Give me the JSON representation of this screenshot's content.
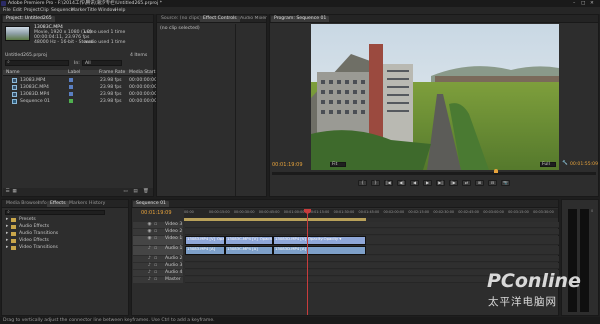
{
  "titlebar": {
    "title": "Adobe Premiere Pro - F:\\2014工作\\腾讯\\潮汐专栏\\Untitled265.prproj *"
  },
  "menu": [
    "File",
    "Edit",
    "Project",
    "Clip",
    "Sequence",
    "Marker",
    "Title",
    "Window",
    "Help"
  ],
  "project": {
    "tabs": [
      "Project: Untitled265"
    ],
    "preview": {
      "name": "13083C.MP4",
      "type": "Movie, 1920 x 1080 (1.0)",
      "duration": "00:00:04:11, 23.976 fps",
      "audio": "48000 Hz - 16-bit - Stereo",
      "usage": "video used 1 time",
      "usage2": "audio used 1 time"
    },
    "count": "4 Items",
    "location": "Untitled265.prproj",
    "in_label": "In:",
    "in_value": "All",
    "search_placeholder": "",
    "columns": [
      "Name",
      "Label",
      "Frame Rate",
      "Media Start"
    ],
    "items": [
      {
        "name": "13083.MP4",
        "label_color": "#5a7fc2",
        "rate": "23.98 fps",
        "start": "00:00:00:00"
      },
      {
        "name": "13083C.MP4",
        "label_color": "#5a7fc2",
        "rate": "23.98 fps",
        "start": "00:00:00:00"
      },
      {
        "name": "13083D.MP4",
        "label_color": "#5a7fc2",
        "rate": "23.98 fps",
        "start": "00:00:00:00"
      },
      {
        "name": "Sequence 01",
        "label_color": "#4fb04f",
        "rate": "23.98 fps",
        "start": "00:00:00:00"
      }
    ]
  },
  "source": {
    "tabs": [
      "Source: (no clips)",
      "Effect Controls",
      "Audio Mixer: Seq"
    ],
    "empty": "(no clip selected)"
  },
  "program": {
    "tab": "Program: Sequence 01",
    "timecode": "00:01:19:09",
    "fit": "Fit",
    "quality": "Full",
    "duration": "00:01:55:09",
    "playhead_fraction": 0.69,
    "controls": [
      "{",
      "}",
      "|◀",
      "◀|",
      "◀",
      "▶",
      "▶|",
      "|▶",
      "⇄",
      "⊞",
      "⊟",
      "📷"
    ]
  },
  "media_browser": {
    "tabs": [
      "Media Browser",
      "Info",
      "Effects",
      "Markers",
      "History"
    ],
    "search_placeholder": "",
    "items": [
      "Presets",
      "Audio Effects",
      "Audio Transitions",
      "Video Effects",
      "Video Transitions"
    ]
  },
  "timeline": {
    "tab": "Sequence 01",
    "timecode": "00:01:19:09",
    "ruler": [
      "00:00",
      "00:00:15:00",
      "00:00:30:00",
      "00:00:45:00",
      "00:01:00:00",
      "00:01:15:00",
      "00:01:30:00",
      "00:01:45:00",
      "00:02:00:00",
      "00:02:15:00",
      "00:02:30:00",
      "00:02:45:00",
      "00:03:00:00",
      "00:03:15:00",
      "00:03:30:00"
    ],
    "tracks": [
      {
        "name": "Video 3",
        "type": "video"
      },
      {
        "name": "Video 2",
        "type": "video"
      },
      {
        "name": "Video 1",
        "type": "video-main"
      },
      {
        "name": "Audio 1",
        "type": "audio-main"
      },
      {
        "name": "Audio 2",
        "type": "audio"
      },
      {
        "name": "Audio 3",
        "type": "audio"
      },
      {
        "name": "Audio 4",
        "type": "audio"
      },
      {
        "name": "Master",
        "type": "master"
      }
    ],
    "video_clips": [
      {
        "label": "13083.MP4 [V]",
        "opacity": "Opacity:Opacity ▾"
      },
      {
        "label": "13083C.MP4 [V]",
        "opacity": "Opacity:Opacity ▾"
      },
      {
        "label": "13083D.MP4 [V]",
        "opacity": "Opacity:Opacity ▾"
      }
    ],
    "audio_clips": [
      {
        "label": "13083.MP4 [A]"
      },
      {
        "label": "13083C.MP4 [A]"
      },
      {
        "label": "13083D.MP4 [A]"
      }
    ]
  },
  "status": {
    "text": "Drag to vertically adjust the connector line between keyframes. Use Ctrl to add a keyframe."
  },
  "watermark": {
    "brand": "PConline",
    "sub": "太平洋电脑网"
  },
  "colors": {
    "accent": "#e8a33c",
    "video_clip": "#8fa7d8",
    "audio_clip": "#7ea0c9",
    "playhead": "#c83c3c"
  }
}
